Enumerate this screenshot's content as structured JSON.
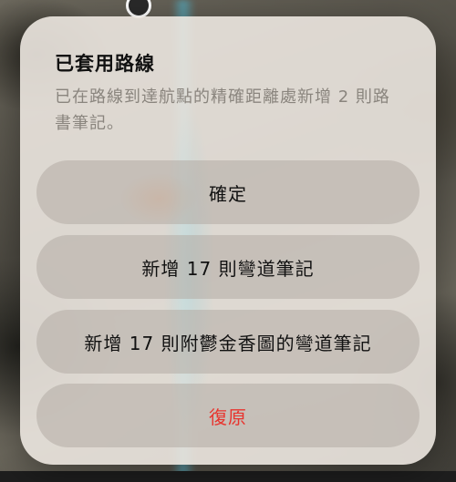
{
  "dialog": {
    "title": "已套用路線",
    "message": "已在路線到達航點的精確距離處新增 2 則路書筆記。",
    "buttons": {
      "confirm": "確定",
      "add_turn_notes": "新增 17 則彎道筆記",
      "add_turn_notes_with_map": "新增 17 則附鬱金香圖的彎道筆記",
      "undo": "復原"
    }
  },
  "colors": {
    "undo_text": "#e8332d",
    "title_text": "#111111",
    "message_text": "#8a857e"
  }
}
